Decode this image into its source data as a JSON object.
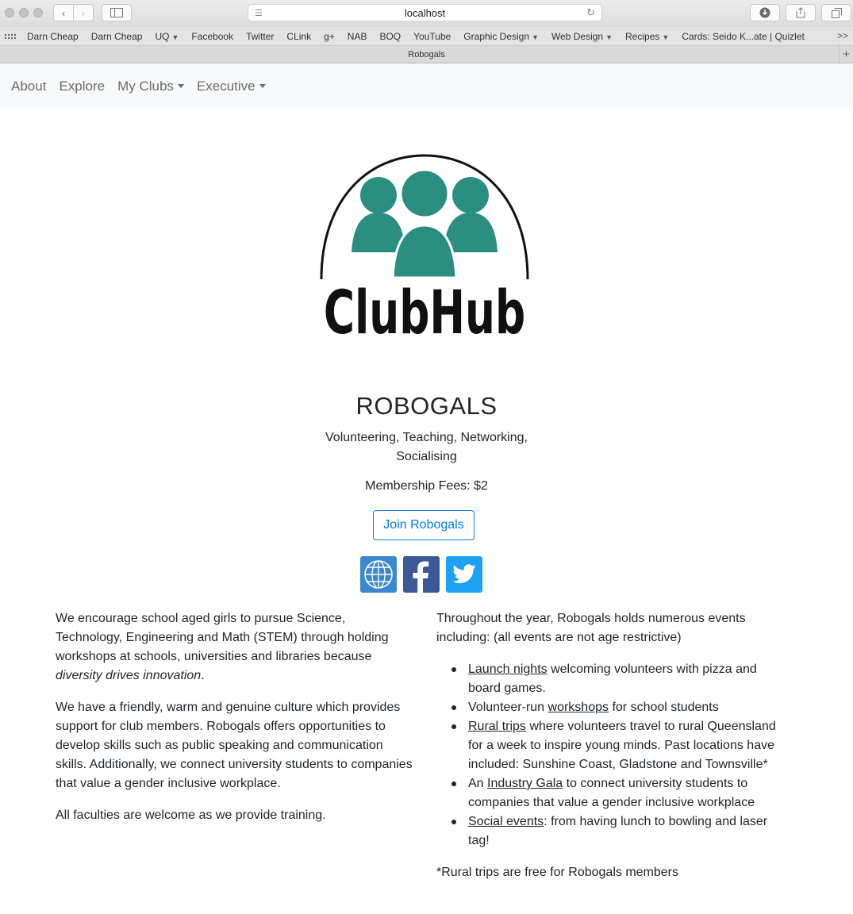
{
  "browser": {
    "url": "localhost",
    "tab_title": "Robogals",
    "bookmarks": [
      {
        "label": "Darn Cheap"
      },
      {
        "label": "Darn Cheap"
      },
      {
        "label": "UQ",
        "dropdown": true
      },
      {
        "label": "Facebook"
      },
      {
        "label": "Twitter"
      },
      {
        "label": "CLink"
      },
      {
        "label": "g+"
      },
      {
        "label": "NAB"
      },
      {
        "label": "BOQ"
      },
      {
        "label": "YouTube"
      },
      {
        "label": "Graphic Design",
        "dropdown": true
      },
      {
        "label": "Web Design",
        "dropdown": true
      },
      {
        "label": "Recipes",
        "dropdown": true
      },
      {
        "label": "Cards: Seido K...ate | Quizlet"
      }
    ],
    "more": ">>"
  },
  "nav": {
    "about": "About",
    "explore": "Explore",
    "my_clubs": "My Clubs",
    "executive": "Executive"
  },
  "logo": {
    "text": "ClubHub",
    "color": "#2a8f80"
  },
  "club": {
    "name": "ROBOGALS",
    "tags_line1": "Volunteering, Teaching, Networking,",
    "tags_line2": "Socialising",
    "fees": "Membership Fees: $2",
    "join_label": "Join Robogals"
  },
  "social": [
    {
      "icon": "globe-icon",
      "color": "#3b88d0"
    },
    {
      "icon": "facebook-icon",
      "color": "#3b5998"
    },
    {
      "icon": "twitter-icon",
      "color": "#1da1f2"
    }
  ],
  "about": {
    "p1_text": "We encourage school aged girls to pursue Science, Technology, Engineering and Math (STEM) through holding workshops at schools, universities and libraries because ",
    "p1_em": "diversity drives innovation",
    "p1_end": ".",
    "p2": "We have a friendly, warm and genuine culture which provides support for club members. Robogals offers opportunities to develop skills such as public speaking and communication skills. Additionally, we connect university students to companies that value a gender inclusive workplace.",
    "p3": "All faculties are welcome as we provide training."
  },
  "events": {
    "intro": "Throughout the year, Robogals holds numerous events including: (all events are not age restrictive)",
    "items": [
      {
        "pre": "",
        "link": "Launch nights",
        "post": " welcoming volunteers with pizza and board games."
      },
      {
        "pre": "Volunteer-run ",
        "link": "workshops",
        "post": " for school students"
      },
      {
        "pre": "",
        "link": "Rural trips",
        "post": " where volunteers travel to rural Queensland for a week to inspire young minds. Past locations have included: Sunshine Coast, Gladstone and Townsville*"
      },
      {
        "pre": "An ",
        "link": "Industry Gala",
        "post": " to connect university students to companies that value a gender inclusive workplace"
      },
      {
        "pre": "",
        "link": "Social events",
        "post": ": from having lunch to bowling and laser tag!"
      }
    ],
    "footnote": "*Rural trips are free for Robogals members"
  }
}
